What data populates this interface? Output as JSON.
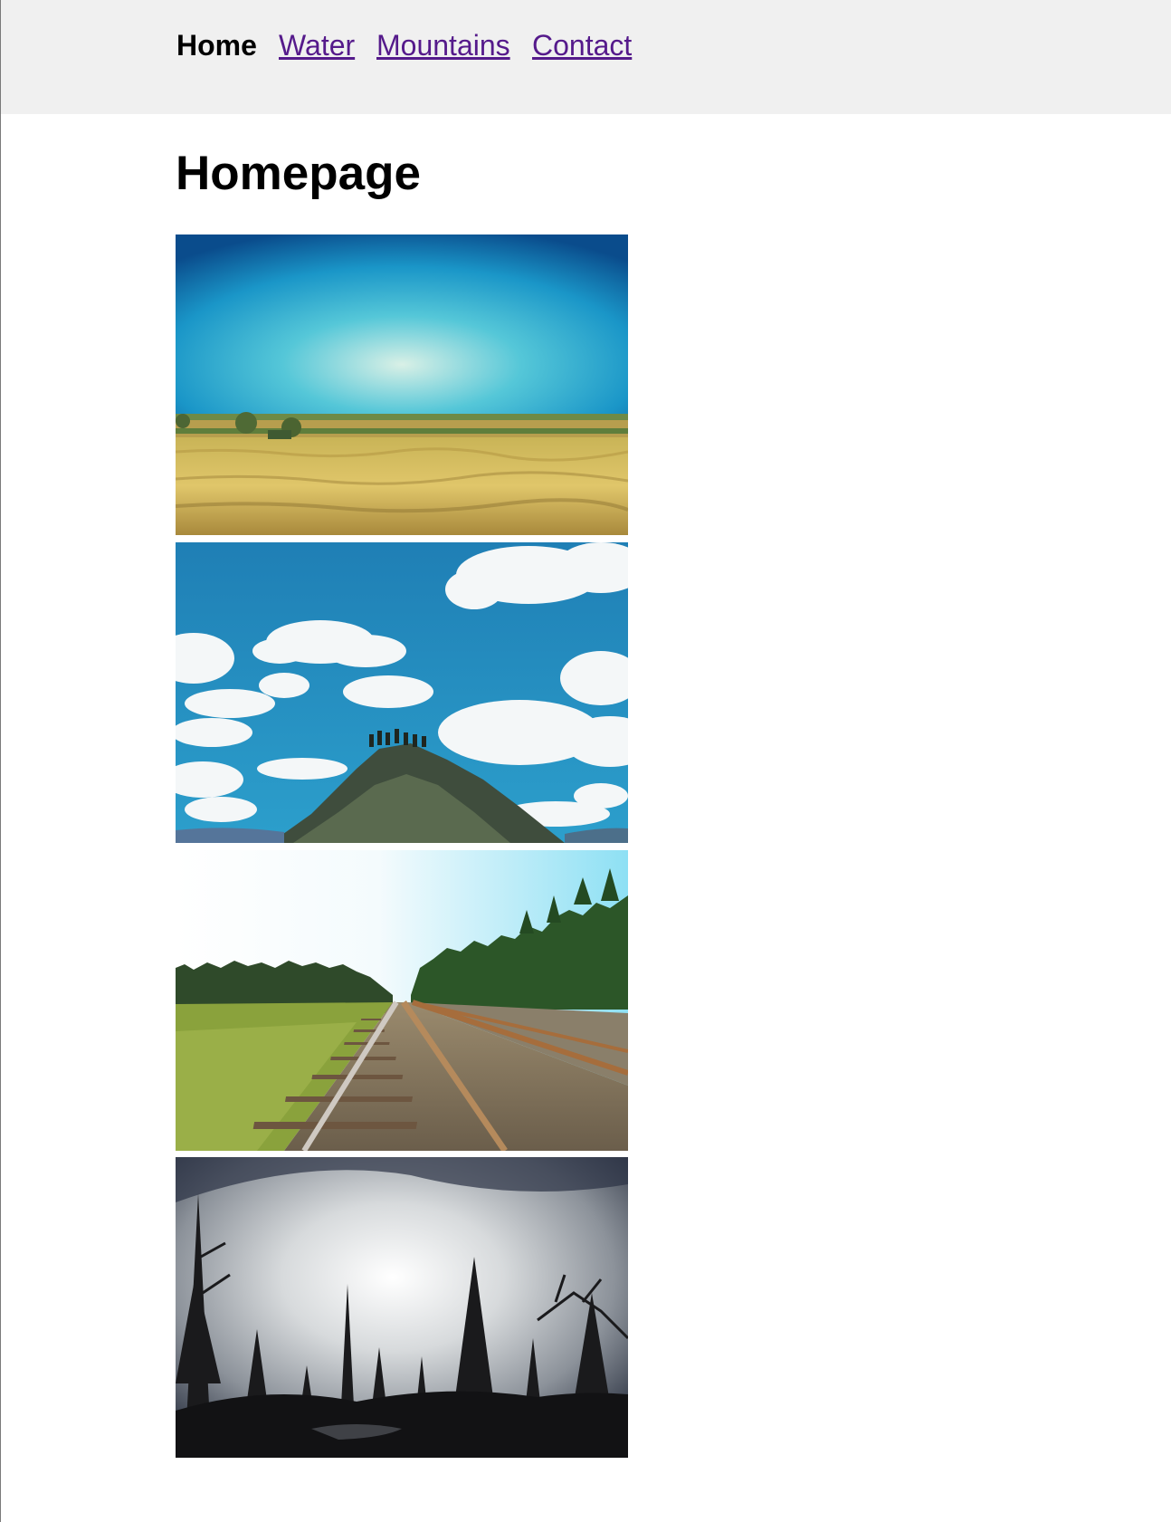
{
  "nav": {
    "home_label": "Home",
    "water_label": "Water",
    "mountains_label": "Mountains",
    "contact_label": "Contact",
    "link_color": "#551a8b",
    "background_color": "#f0f0f0"
  },
  "page": {
    "title": "Homepage"
  },
  "gallery": {
    "images": [
      {
        "subject": "wheat-field-under-blue-sky"
      },
      {
        "subject": "people-on-rocky-peak-with-clouds"
      },
      {
        "subject": "railway-tracks-through-forest"
      },
      {
        "subject": "misty-forest-silhouette"
      }
    ]
  }
}
